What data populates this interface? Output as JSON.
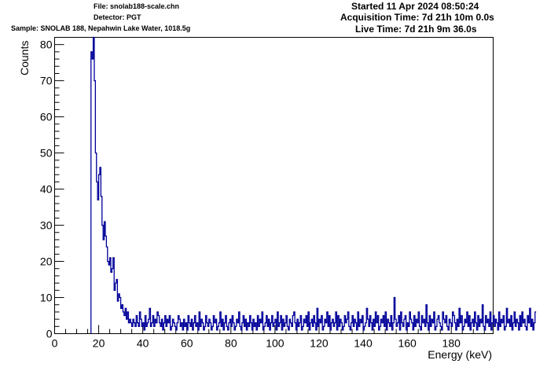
{
  "header": {
    "file": "File: snolab188-scale.chn",
    "detector": "Detector: PGT",
    "sample": "Sample: SNOLAB 188, Nepahwin Lake Water, 1018.5g",
    "started": "Started 11 Apr 2024 08:50:24",
    "acquisition_time": "Acquisition Time: 7d 21h 10m 0.0s",
    "live_time": "Live Time: 7d 21h 9m 36.0s"
  },
  "chart_data": {
    "type": "line",
    "title": "",
    "xlabel": "Energy (keV)",
    "ylabel": "Counts",
    "xlim": [
      0,
      199
    ],
    "ylim": [
      0,
      82
    ],
    "x_ticks": [
      0,
      20,
      40,
      60,
      80,
      100,
      120,
      140,
      160,
      180
    ],
    "y_ticks": [
      0,
      10,
      20,
      30,
      40,
      50,
      60,
      70,
      80
    ],
    "grid": false,
    "legend": "none",
    "line_color": "#000099",
    "series": [
      {
        "bin_width": 0.5,
        "x_start": 16.5,
        "values": [
          78,
          76,
          82,
          70,
          50,
          42,
          37,
          44,
          46,
          38,
          30,
          26,
          31,
          27,
          24,
          20,
          19,
          21,
          17,
          18,
          21,
          12,
          14,
          15,
          9,
          11,
          10,
          7,
          8,
          6,
          5,
          7,
          4,
          6,
          3,
          4,
          3,
          2,
          4,
          3,
          2,
          5,
          3,
          2,
          6,
          4,
          2,
          3,
          1,
          5,
          2,
          3,
          4,
          7,
          2,
          3,
          5,
          2,
          4,
          3,
          6,
          5,
          3,
          2,
          4,
          1,
          3,
          5,
          2,
          4,
          3,
          5,
          1,
          2,
          4,
          3,
          2,
          1,
          3,
          5,
          4,
          2,
          3,
          1,
          4,
          2,
          3,
          1,
          5,
          3,
          2,
          4,
          1,
          3,
          5,
          2,
          3,
          1,
          6,
          2,
          4,
          3,
          1,
          2,
          5,
          3,
          2,
          4,
          3,
          1,
          2,
          5,
          3,
          4,
          1,
          2,
          3,
          6,
          2,
          4,
          1,
          3,
          5,
          2,
          1,
          3,
          4,
          2,
          5,
          3,
          1,
          2,
          4,
          3,
          6,
          2,
          1,
          3,
          5,
          2,
          4,
          1,
          3,
          2,
          5,
          3,
          1,
          4,
          2,
          3,
          1,
          5,
          2,
          4,
          3,
          6,
          1,
          2,
          3,
          5,
          2,
          4,
          1,
          3,
          5,
          2,
          3,
          4,
          1,
          6,
          2,
          3,
          5,
          1,
          4,
          2,
          3,
          5,
          2,
          1,
          4,
          3,
          2,
          5,
          6,
          3,
          1,
          4,
          2,
          3,
          5,
          1,
          2,
          4,
          3,
          5,
          2,
          6,
          1,
          3,
          4,
          2,
          5,
          3,
          1,
          7,
          2,
          4,
          3,
          5,
          1,
          2,
          4,
          3,
          6,
          2,
          5,
          1,
          3,
          4,
          2,
          3,
          6,
          1,
          5,
          2,
          4,
          3,
          1,
          2,
          5,
          3,
          4,
          6,
          2,
          1,
          3,
          5,
          2,
          4,
          3,
          1,
          6,
          2,
          4,
          3,
          5,
          1,
          2,
          3,
          7,
          4,
          2,
          5,
          3,
          1,
          4,
          2,
          6,
          3,
          5,
          1,
          2,
          4,
          3,
          5,
          2,
          6,
          1,
          4,
          3,
          2,
          5,
          1,
          3,
          10,
          4,
          2,
          3,
          5,
          1,
          6,
          3,
          2,
          4,
          5,
          1,
          3,
          2,
          6,
          4,
          3,
          1,
          5,
          2,
          4,
          3,
          6,
          2,
          1,
          5,
          3,
          4,
          2,
          8,
          3,
          1,
          5,
          2,
          4,
          3,
          6,
          1,
          2,
          4,
          5,
          3,
          2,
          1,
          6,
          4,
          3,
          5,
          2,
          1,
          4,
          3,
          2,
          6,
          5,
          3,
          1,
          4,
          2,
          7,
          3,
          5,
          1,
          2,
          4,
          3,
          6,
          2,
          5,
          1,
          3,
          4,
          2,
          6,
          3,
          1,
          5,
          2,
          4,
          3,
          8,
          2,
          1,
          5,
          3,
          4,
          2,
          6,
          1,
          3,
          5,
          2,
          4,
          3,
          1,
          6,
          2,
          4,
          3,
          5,
          1,
          2,
          7,
          3,
          4,
          2,
          5,
          1,
          3,
          6,
          2,
          4,
          3,
          1,
          5,
          2,
          6,
          3,
          4,
          2,
          1,
          5,
          3,
          7,
          2,
          4,
          1,
          3,
          6
        ]
      }
    ]
  }
}
